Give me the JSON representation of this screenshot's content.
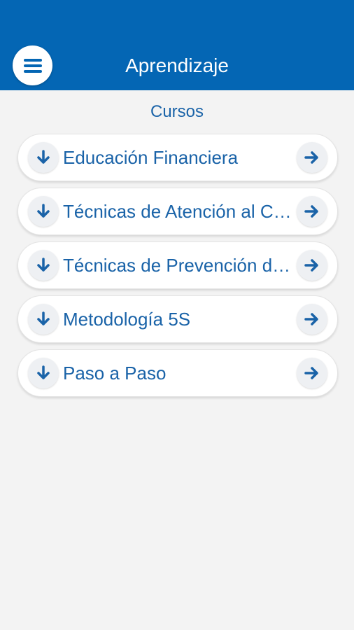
{
  "header": {
    "title": "Aprendizaje",
    "menu_icon": "hamburger-menu-icon",
    "background_color": "#0466b4"
  },
  "section": {
    "title": "Cursos"
  },
  "courses": [
    {
      "label": "Educación Financiera",
      "left_icon": "arrow-down-icon",
      "right_icon": "arrow-right-icon"
    },
    {
      "label": "Técnicas de Atención al Cliente",
      "left_icon": "arrow-down-icon",
      "right_icon": "arrow-right-icon"
    },
    {
      "label": "Técnicas de Prevención de Lavado de Activos",
      "left_icon": "arrow-down-icon",
      "right_icon": "arrow-right-icon"
    },
    {
      "label": "Metodología 5S",
      "left_icon": "arrow-down-icon",
      "right_icon": "arrow-right-icon"
    },
    {
      "label": "Paso a Paso",
      "left_icon": "arrow-down-icon",
      "right_icon": "arrow-right-icon"
    }
  ],
  "colors": {
    "accent": "#1a63a8",
    "background": "#f3f3f3"
  }
}
